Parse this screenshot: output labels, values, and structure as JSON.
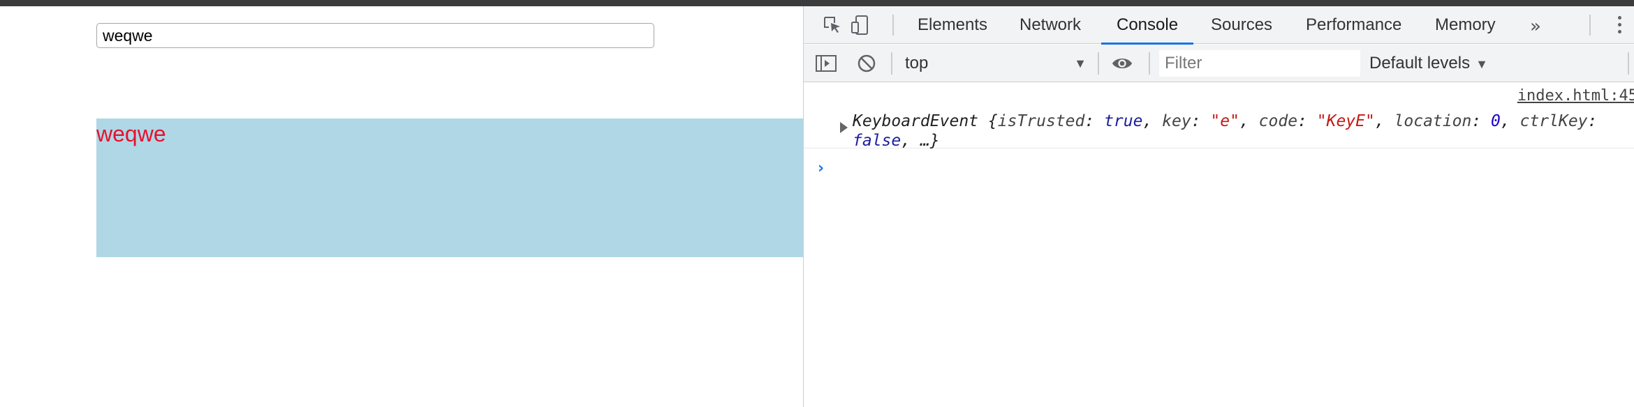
{
  "page": {
    "input_value": "weqwe",
    "box_text": "weqwe",
    "colors": {
      "box_bg": "#b0d7e6",
      "box_text": "#e8112d"
    }
  },
  "devtools": {
    "tabs": [
      {
        "label": "Elements"
      },
      {
        "label": "Network"
      },
      {
        "label": "Console",
        "active": true
      },
      {
        "label": "Sources"
      },
      {
        "label": "Performance"
      },
      {
        "label": "Memory"
      }
    ],
    "more_tabs": "»",
    "icons": {
      "inspect": "inspect-element-icon",
      "device": "device-toolbar-icon",
      "sidebar": "console-sidebar-icon",
      "clear": "clear-console-icon",
      "eye": "live-expression-icon",
      "kebab": "more-options-icon"
    },
    "toolbar": {
      "context": "top",
      "filter_placeholder": "Filter",
      "levels": "Default levels"
    },
    "console": {
      "source": "index.html:45",
      "message": {
        "class": "KeyboardEvent",
        "brace_open": "{",
        "props": [
          {
            "key": "isTrusted",
            "value": "true",
            "type": "kw"
          },
          {
            "key": "key",
            "value": "\"e\"",
            "type": "str"
          },
          {
            "key": "code",
            "value": "\"KeyE\"",
            "type": "str"
          },
          {
            "key": "location",
            "value": "0",
            "type": "num"
          },
          {
            "key": "ctrlKey",
            "value": "false",
            "type": "kw"
          }
        ],
        "ellipsis": "…}"
      },
      "prompt": "›"
    },
    "accent": "#1a73e8"
  }
}
